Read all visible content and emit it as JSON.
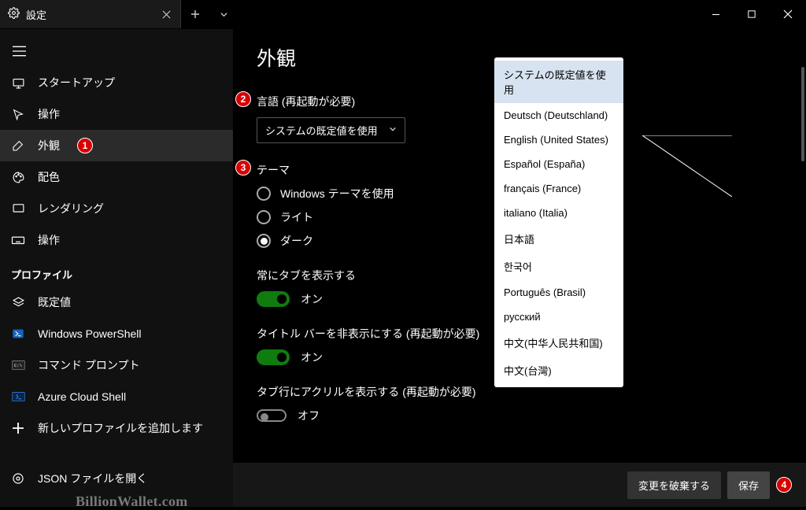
{
  "titlebar": {
    "tab_title": "設定"
  },
  "sidebar": {
    "items": [
      {
        "label": "スタートアップ"
      },
      {
        "label": "操作"
      },
      {
        "label": "外観"
      },
      {
        "label": "配色"
      },
      {
        "label": "レンダリング"
      },
      {
        "label": "操作"
      }
    ],
    "section_label": "プロファイル",
    "profiles": [
      {
        "label": "既定値"
      },
      {
        "label": "Windows PowerShell"
      },
      {
        "label": "コマンド プロンプト"
      },
      {
        "label": "Azure Cloud Shell"
      },
      {
        "label": "新しいプロファイルを追加します"
      },
      {
        "label": "JSON ファイルを開く"
      }
    ]
  },
  "page": {
    "title": "外観",
    "language_label": "言語 (再起動が必要)",
    "language_value": "システムの既定値を使用",
    "theme_label": "テーマ",
    "theme_options": {
      "windows": "Windows テーマを使用",
      "light": "ライト",
      "dark": "ダーク"
    },
    "always_show_tabs_label": "常にタブを表示する",
    "always_show_tabs_value": "オン",
    "hide_titlebar_label": "タイトル バーを非表示にする (再起動が必要)",
    "hide_titlebar_value": "オン",
    "acrylic_tab_label": "タブ行にアクリルを表示する (再起動が必要)",
    "acrylic_tab_value": "オフ"
  },
  "dropdown_options": [
    "システムの既定値を使用",
    "Deutsch (Deutschland)",
    "English (United States)",
    "Español (España)",
    "français (France)",
    "italiano (Italia)",
    "日本語",
    "한국어",
    "Português (Brasil)",
    "русский",
    "中文(中华人民共和国)",
    "中文(台灣)"
  ],
  "buttons": {
    "discard": "変更を破棄する",
    "save": "保存"
  },
  "badges": {
    "one": "1",
    "two": "2",
    "three": "3",
    "four": "4"
  },
  "watermark": "BillionWallet.com"
}
